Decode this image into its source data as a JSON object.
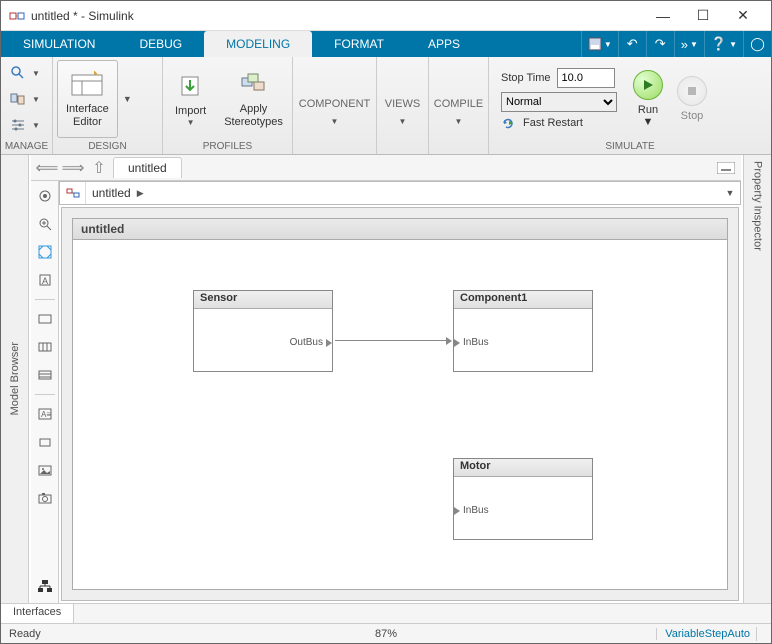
{
  "window": {
    "title": "untitled * - Simulink"
  },
  "tabs": {
    "simulation": "SIMULATION",
    "debug": "DEBUG",
    "modeling": "MODELING",
    "format": "FORMAT",
    "apps": "APPS"
  },
  "ribbon": {
    "manage_label": "MANAGE",
    "design_label": "DESIGN",
    "profiles_label": "PROFILES",
    "component_label": "COMPONENT",
    "views_label": "VIEWS",
    "compile_label": "COMPILE",
    "simulate_label": "SIMULATE",
    "interface_editor": "Interface\nEditor",
    "import": "Import",
    "apply_stereotypes": "Apply\nStereotypes",
    "stop_time_label": "Stop Time",
    "stop_time_value": "10.0",
    "mode": "Normal",
    "fast_restart": "Fast Restart",
    "run": "Run",
    "stop": "Stop"
  },
  "nav": {
    "crumb": "untitled"
  },
  "address": {
    "model": "untitled"
  },
  "left_rail": "Model Browser",
  "right_rail": "Property Inspector",
  "canvas": {
    "title": "untitled",
    "blocks": {
      "sensor": {
        "name": "Sensor",
        "out_port": "OutBus"
      },
      "component1": {
        "name": "Component1",
        "in_port": "InBus"
      },
      "motor": {
        "name": "Motor",
        "in_port": "InBus"
      }
    }
  },
  "bottom_tab": "Interfaces",
  "status": {
    "ready": "Ready",
    "progress": "87%",
    "solver": "VariableStepAuto"
  }
}
